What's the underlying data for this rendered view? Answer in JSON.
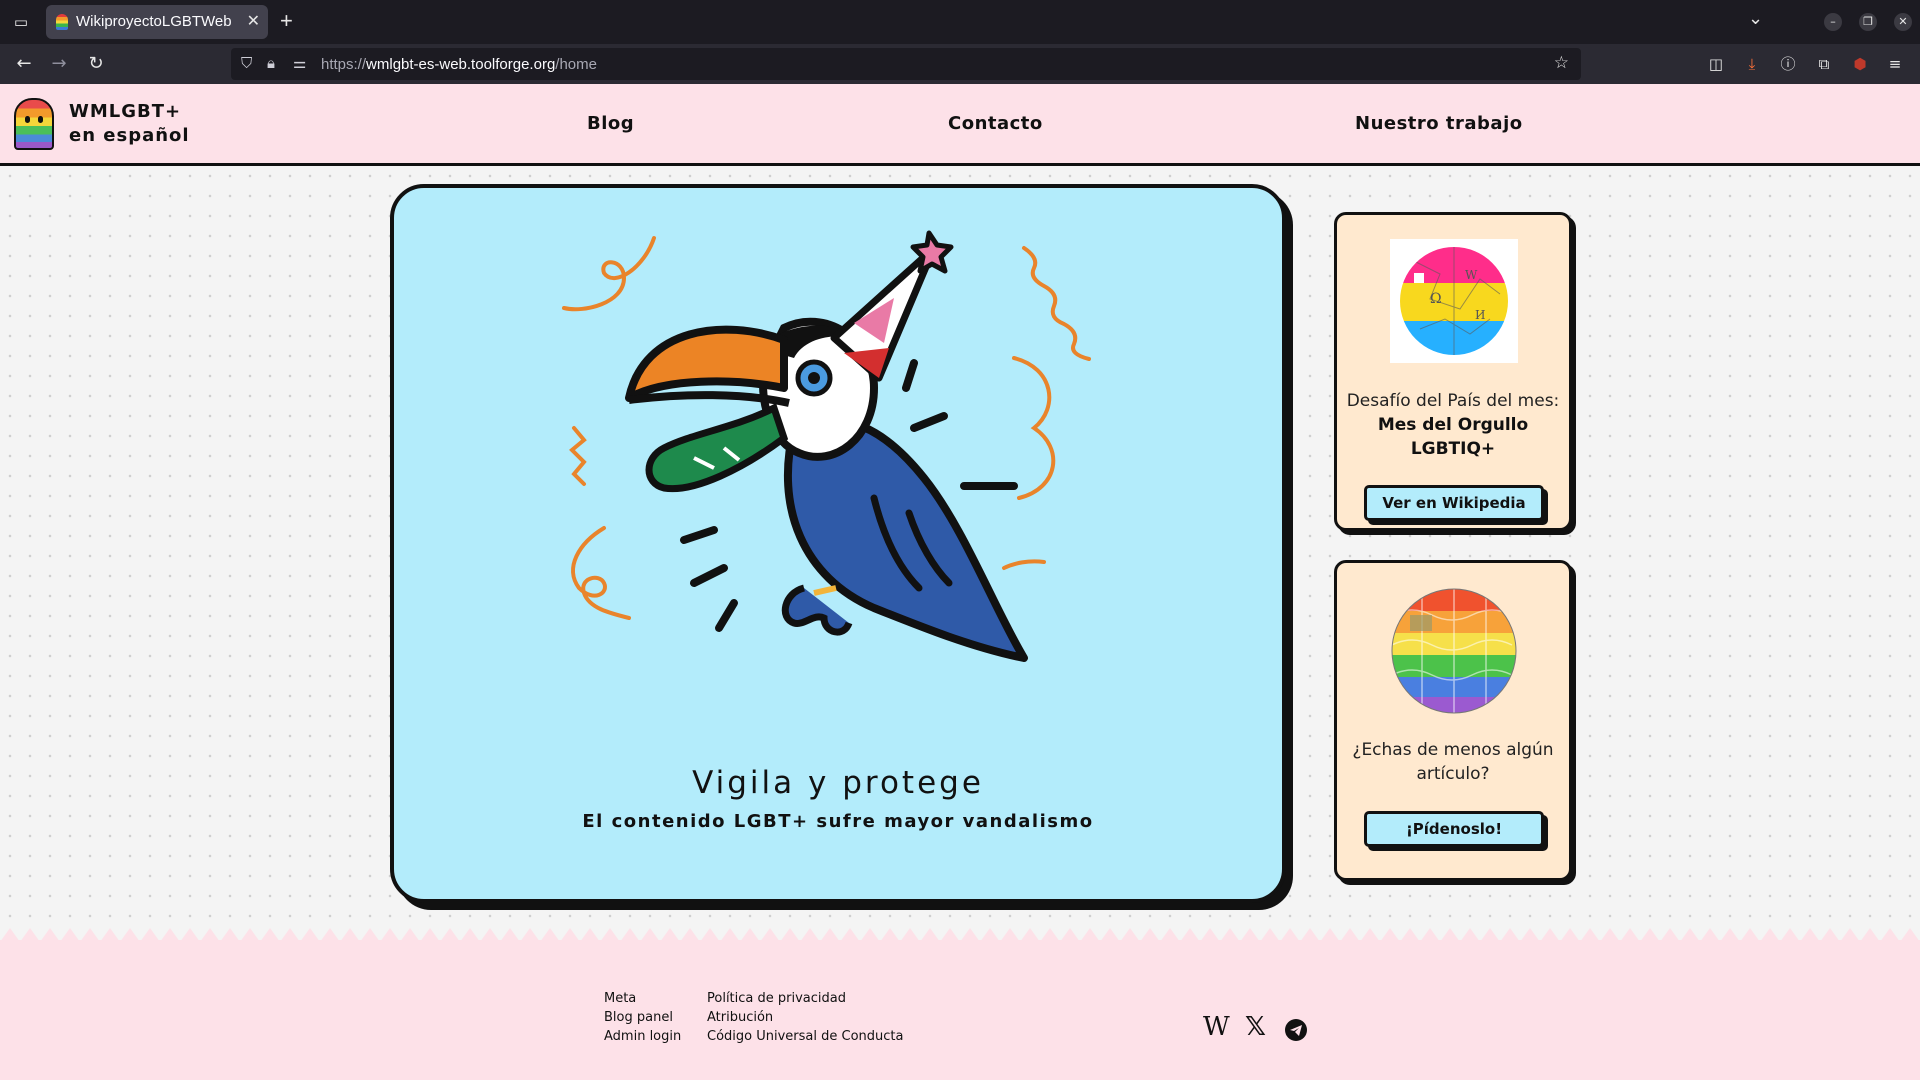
{
  "browser": {
    "tab_title": "WikiproyectoLGBTWeb",
    "url_scheme": "https://",
    "url_host": "wmlgbt-es-web.toolforge.org",
    "url_path": "/home"
  },
  "site": {
    "logo_line1": "WMLGBT+",
    "logo_line2": "en español",
    "menu": [
      "Blog",
      "Contacto",
      "Nuestro trabajo"
    ]
  },
  "hero": {
    "title": "Vigila y protege",
    "subtitle": "El contenido LGBT+ sufre mayor vandalismo",
    "illustration": "party-toucan"
  },
  "cards": [
    {
      "text_prefix": "Desafío del País del mes: ",
      "text_bold": "Mes del Orgullo LGBTIQ+",
      "button": "Ver en Wikipedia",
      "image": "pan-flag-wikipedia-globe"
    },
    {
      "text": "¿Echas de menos algún artículo?",
      "button": "¡Pídenoslo!",
      "image": "rainbow-wikipedia-globe"
    }
  ],
  "footer": {
    "col1": [
      "Meta",
      "Blog panel",
      "Admin login"
    ],
    "col2": [
      "Política de privacidad",
      "Atribución",
      "Código Universal de Conducta"
    ],
    "social": [
      "wikipedia-icon",
      "x-icon",
      "telegram-icon"
    ]
  },
  "colors": {
    "header_bg": "#fde1e8",
    "hero_bg": "#b3ecfb",
    "card_bg": "#ffe9cf",
    "button_bg": "#b3ecfb"
  }
}
